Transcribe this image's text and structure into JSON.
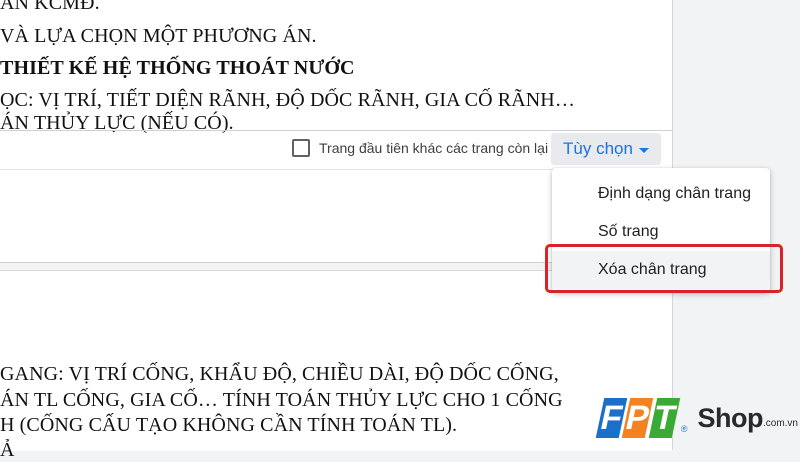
{
  "document": {
    "top_lines": [
      {
        "text": "ÁN KCMĐ.",
        "bold": false
      },
      {
        "text": "VÀ LỰA CHỌN MỘT PHƯƠNG ÁN.",
        "bold": false
      },
      {
        "text": "THIẾT KẾ HỆ THỐNG THOÁT NƯỚC",
        "bold": true
      },
      {
        "text": "ỌC: VỊ TRÍ, TIẾT DIỆN RÃNH, ĐỘ DỐC RÃNH, GIA CỐ RÃNH…",
        "bold": false
      },
      {
        "text": "ÁN THỦY LỰC (NẾU CÓ).",
        "bold": false
      }
    ],
    "bottom_lines": [
      {
        "text": "GANG: VỊ TRÍ CỐNG, KHẨU ĐỘ, CHIỀU DÀI, ĐỘ DỐC CỐNG,",
        "bold": false
      },
      {
        "text": "ÁN TL CỐNG, GIA CỐ… TÍNH TOÁN THỦY LỰC CHO 1 CỐNG",
        "bold": false
      },
      {
        "text": "H (CỐNG CẤU TẠO KHÔNG CẦN TÍNH TOÁN TL).",
        "bold": false
      },
      {
        "text": "Ả",
        "bold": false
      }
    ]
  },
  "footer_bar": {
    "checkbox_label": "Trang đầu tiên khác các trang còn lại",
    "checkbox_checked": false,
    "options_label": "Tùy chọn"
  },
  "menu": {
    "items": [
      {
        "label": "Định dạng chân trang"
      },
      {
        "label": "Số trang"
      },
      {
        "label": "Xóa chân trang"
      }
    ],
    "highlighted_item": "Xóa chân trang"
  },
  "logo": {
    "letters": [
      "F",
      "P",
      "T"
    ],
    "brand": "Shop",
    "domain": ".com.vn",
    "registered": "®"
  },
  "colors": {
    "accent": "#1a73e8",
    "highlight_border": "#d9232a",
    "fpt_blue": "#1a6fc9",
    "fpt_orange": "#f58220",
    "fpt_green": "#3aaa35"
  }
}
